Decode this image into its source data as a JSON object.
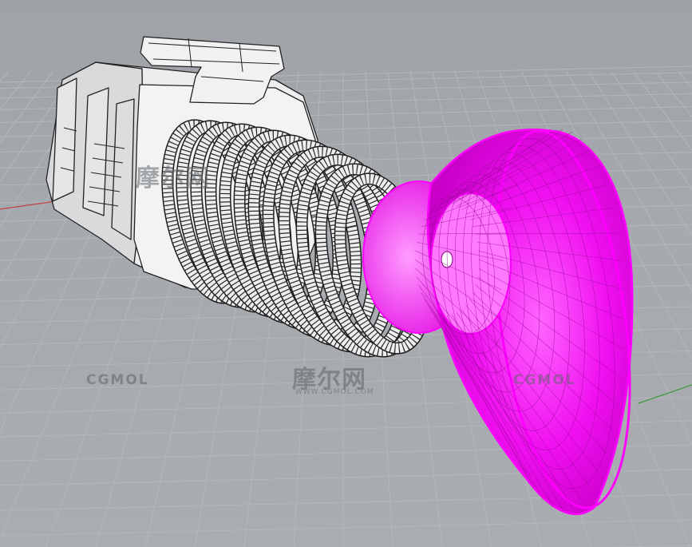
{
  "viewport": {
    "background": "#a5a9ad",
    "grid_color": "#b3b7ba",
    "highlight_color": "#ff00ff"
  },
  "watermarks": {
    "cgmol_left": "CGMOL",
    "cgmol_right": "CGMOL",
    "cn_top": "摩尔网",
    "cn_mid": "摩尔网",
    "cn_mid_sub": "WWW.CGMOL.COM"
  },
  "axes": {
    "x_axis_color": "#c24040",
    "y_axis_color": "#3f9a3f"
  }
}
